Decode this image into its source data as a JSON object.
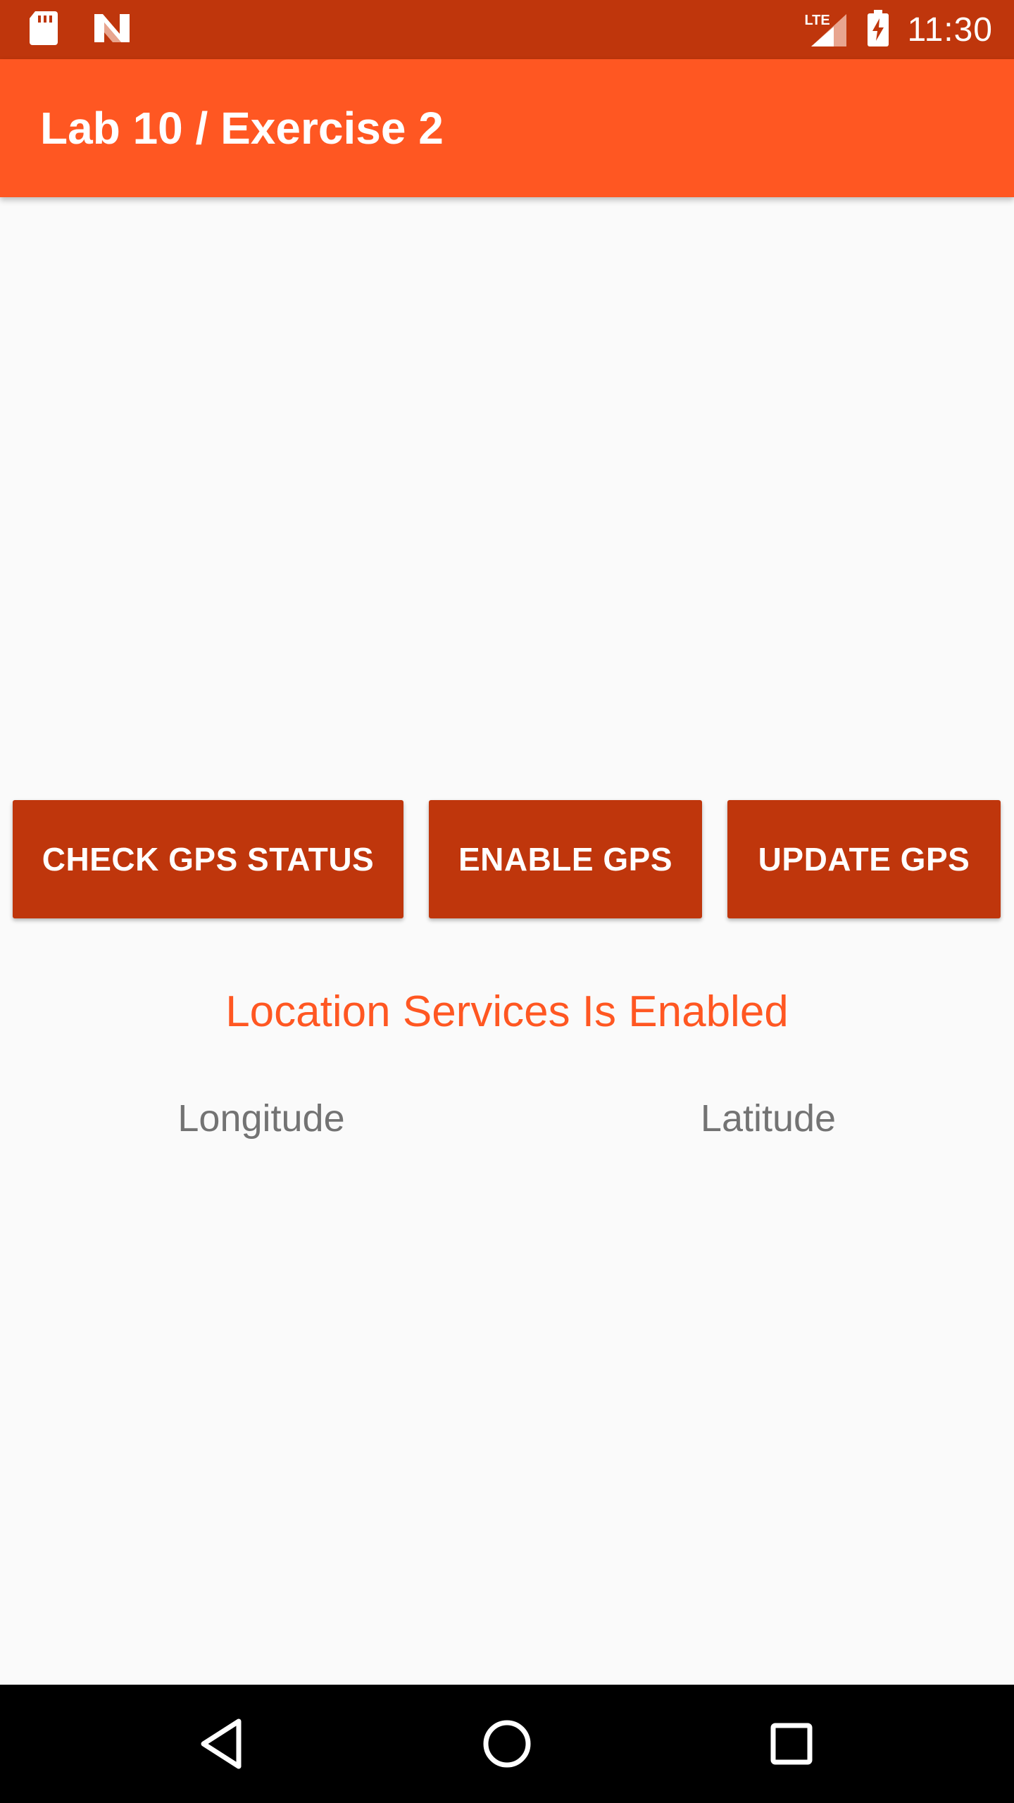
{
  "status_bar": {
    "time": "11:30",
    "network_label": "LTE",
    "icons": [
      "sd-card-icon",
      "n-logo-icon",
      "signal-icon",
      "battery-charging-icon"
    ]
  },
  "app_bar": {
    "title": "Lab 10 / Exercise 2"
  },
  "buttons": {
    "check_gps_status": "CHECK GPS STATUS",
    "enable_gps": "ENABLE GPS",
    "update_gps": "UPDATE GPS"
  },
  "location_status": "Location Services Is Enabled",
  "coordinates": {
    "longitude_label": "Longitude",
    "latitude_label": "Latitude"
  },
  "nav_bar": {
    "icons": [
      "back-icon",
      "home-icon",
      "recent-apps-icon"
    ]
  },
  "colors": {
    "primary": "#ff5722",
    "primary_dark": "#bf360c",
    "background": "#fafafa",
    "secondary_text": "#737373"
  }
}
